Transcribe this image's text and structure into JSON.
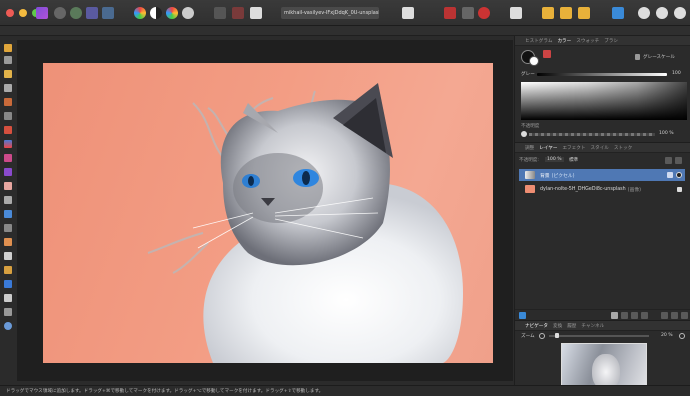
{
  "toolbar": {
    "document_name": "mikhail-vasilyev-IFxjDdqK_0U-unsplash"
  },
  "color_panel": {
    "tabs": [
      "ヒストグラム",
      "カラー",
      "スウォッチ",
      "ブラシ"
    ],
    "active_tab": "カラー",
    "mode": "グレースケール",
    "gray_label": "グレー",
    "gray_value": "100",
    "opacity_label": "不透明度",
    "opacity_value": "100 %"
  },
  "layers_panel": {
    "tabs": [
      "調整",
      "レイヤー",
      "エフェクト",
      "スタイル",
      "ストック"
    ],
    "active_tab": "レイヤー",
    "opacity_label": "不透明度:",
    "opacity_value": "100 %",
    "blend_mode": "標準",
    "layers": [
      {
        "name": "背景",
        "kind": "(ピクセル)",
        "selected": true
      },
      {
        "name": "dylan-nolte-5H_DHGeDi8c-unsplash",
        "kind": "(画像)",
        "selected": false
      }
    ]
  },
  "navigator_panel": {
    "tabs": [
      "ナビゲータ",
      "変換",
      "履歴",
      "チャンネル"
    ],
    "active_tab": "ナビゲータ",
    "zoom_label": "ズーム",
    "zoom_value": "20 %"
  },
  "status": {
    "text": "ドラッグでマウス領域に追加します。ドラッグ+⌘で移動してマークを付けます。ドラッグ+⌥で移動してマークを付けます。ドラッグ+⇧で移動します。"
  },
  "colors": {
    "accent": "#4a90d9",
    "background_orange": "#f09a80"
  }
}
